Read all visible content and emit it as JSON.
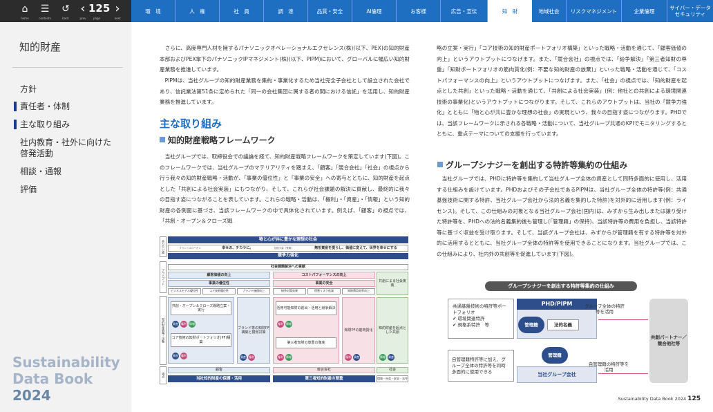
{
  "topbar": {
    "home_label": "home",
    "contents_label": "contents",
    "back_label": "back",
    "prev_label": "prev",
    "page_label": "page",
    "next_label": "next",
    "page_number": "125"
  },
  "nav": [
    "環　境",
    "人　権",
    "社　員",
    "調　達",
    "品質・安全",
    "AI倫理",
    "お客様",
    "広告・宣伝",
    "知　財",
    "地域社会",
    "リスクマネジメント",
    "企業倫理",
    "サイバー・データ セキュリティ"
  ],
  "sidebar": {
    "section_title": "知的財産",
    "items": [
      "方針",
      "責任者・体制",
      "主な取り組み",
      "社内教育・社外に向けた",
      "啓発活動",
      "相談・通報",
      "評価"
    ]
  },
  "brand": {
    "line1": "Sustainability",
    "line2": "Data Book",
    "line3": "2024"
  },
  "body": {
    "p1": "さらに、高度専門人材を擁するパナソニックオペレーショナルエクセレンス(株)(以下、PEX)の知的財産本部およびPEX傘下のパナソニックIPマネジメント(株)(以下、PIPM)において、グローバルに幅広い知的財産業務を推進しています。",
    "p2": "PIPMは、当社グループの知的財産業務を集約・事業化するため当社完全子会社として設立された会社であり、信託業法第51条に定められた「同一の会社集団に属する者の間における信託」を活用し、知的財産業務を推進しています。",
    "h2": "主な取り組み",
    "h3a": "知的財産戦略フレームワーク",
    "p3": "当社グループでは、取締役会での議論を経て、知的財産戦略フレームワークを策定しています(下図)。このフレームワークでは、当社グループのマテリアリティを踏まえ、「顧客」「競合会社」「社会」の視点から行う我々の知的財産戦略・活動が、「事業の優位性」と「事業の安全」への寄与とともに、知的財産を起点とした「共創による社会実装」にもつながり、そして、これらが社会課題の解決に貢献し、最終的に我々の目指す姿につながることを表しています。これらの戦略・活動は、「権利」・「資産」・「情報」という知的財産の各側面に基づき、当該フレームワークの中で具体化されています。例えば、「顧客」の視点では、「共創・オープン＆クローズ戦",
    "p4": "略の立案・実行」「コア技術の知的財産ポートフォリオ構築」といった戦略・活動を通じて、「顧客価値の向上」というアウトプットにつなげます。また、「競合会社」の視点では、「紛争解決」「第三者知財の尊重」「知財ポートフォリオの筋肉質化(例：不要な知的財産の放棄)」といった戦略・活動を通じて、「コストパフォーマンスの向上」というアウトプットにつなげます。また、「社会」の視点では、「知的財産を起点とした共創」といった戦略・活動を通じて、「共創による社会実装」(例：他社との共創による環境関連技術の事業化)というアウトプットにつながります。そして、これらのアウトプットは、当社の「競争力強化」とともに「物と心が共に豊かな理想の社会」の実現という、我々の目指す姿につながります。PHDでは、当該フレームワークに示される各戦略・活動について、当社グループ共通のKPIでモニタリングするとともに、重点テーマについての支援を行っています。",
    "h3b": "グループシナジーを創出する特許等集約の仕組み",
    "p5": "当社グループでは、PHDに特許等を集約して当社グループ全体の資産として同時多面的に使用し、活用する仕組みを設けています。PHDおよびその子会社であるPIPMは、当社グループ全体の特許等(例：共通基盤技術に関する特許、当社グループ会社から法的名義を集約した特許)を対外的に活用します(例：ライセンス)。そして、この仕組みの対象となる当社グループ会社(国内)は、みずから生み出しまたは譲り受けた特許等を、PHDへの法的名義集約後も管理し(「管理籍」の保持)、当該特許等の費用を負担し、当該特許等に基づく収益を受け取ります。そして、当該グループ会社は、みずからが管理籍を有する特許等を対外的に活用するとともに、当社グループ全体の特許等を使用できることになります。当社グループでは、この仕組みにより、社内外の共創等を促進しています(下図)。"
  },
  "fig1": {
    "side_top": "ありたい姿",
    "side_mid": "アウトプット",
    "side_low": "知的財産戦略・活動",
    "side_bot": "視点",
    "goal": "物と心が共に豊かな理想の社会",
    "mission_tag": "ブランドスローガン",
    "mission": "幸せの、チカラに。",
    "purpose_tag": "目指す姿（長期）",
    "purpose": "無形資産を提らし、価値に変えて、世界を幸せにする",
    "compete": "競争力強化",
    "social": "社会課題解決への貢献",
    "cust_value": "顧客価値の向上",
    "cost_perf": "コストパフォーマンスの向上",
    "cocreate_impl": "共創による社会実装",
    "biz_adv": "事業の優位性",
    "biz_safe": "事業の安全",
    "kpi1": "ビジネスモデル優位性",
    "kpi2": "コア技術優位性",
    "kpi3": "ブランド価値向上",
    "kpi4": "紛争対策効果",
    "kpi5": "侵害リスク低減",
    "kpi6": "知財費用効率向上",
    "act1": "共創・オープン＆クローズ戦略立案・実行",
    "act2": "コア技術の知財ポートフォリオ(PF)構築",
    "act3": "ブランド等の知財PF構築と模倣対策",
    "act4": "活用可能知財の創出・活用と紛争解決",
    "act5": "第三者知財の尊重の徹底",
    "act6": "知財PFの筋肉質化",
    "act7": "知的財産を起点とした共創",
    "tag_right": "権利",
    "tag_asset": "資産",
    "tag_info": "情報",
    "view_cust": "顧客",
    "view_comp": "競合会社",
    "view_soc": "社会",
    "base_left": "当社知的財産の保護・活用",
    "base_mid": "第三者知的財産の尊重",
    "base_right": "環境・社会・安全・法令"
  },
  "fig2": {
    "title": "グループシナジーを創出する特許等集約の仕組み",
    "left_top": "共通基盤技術の特許等ポートフォリオ",
    "left_top_i1": "✔ 環境関連特許",
    "left_top_i2": "✔ 規格系特許　等",
    "left_bot": "自管理籍特許等に加え、グループ全体の特許等を同時多面的に使用できる",
    "phd": "PHD/PIPM",
    "mgmt": "管理籍",
    "legal": "法的名義",
    "mgmt2": "管理籍",
    "group_co": "当社グループ会社",
    "arrow_top": "グループ全体の特許等を活用",
    "arrow_bot": "自管理籍の特許等を活用",
    "partner": "共創パートナー／競合他社等"
  },
  "footer": {
    "book": "Sustainability Data Book 2024",
    "page": "125"
  }
}
